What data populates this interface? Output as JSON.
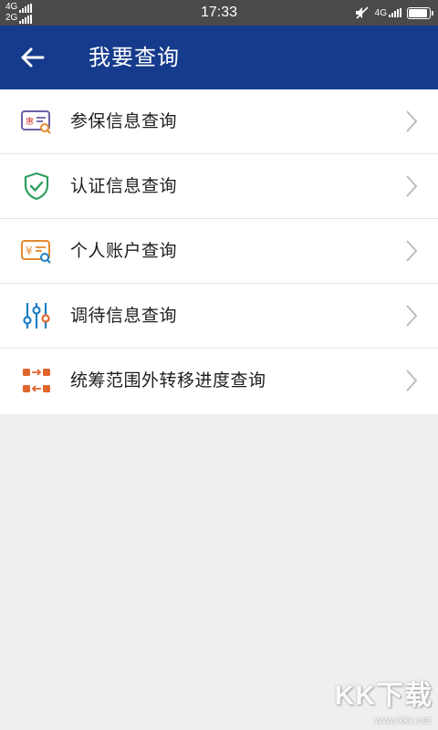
{
  "status_bar": {
    "time": "17:33",
    "sim1_network": "4G",
    "sim2_network": "2G",
    "right_network": "4G",
    "battery_level": 0.95,
    "icons": [
      "signal-bars-icon",
      "mute-icon",
      "battery-icon"
    ]
  },
  "app_bar": {
    "title": "我要查询",
    "back_icon": "arrow-left-icon",
    "background": "#163b8c"
  },
  "menu": {
    "items": [
      {
        "label": "参保信息查询",
        "icon": "insurance-card-search-icon",
        "icon_color": "#6a5fa3"
      },
      {
        "label": "认证信息查询",
        "icon": "shield-check-icon",
        "icon_color": "#2f9e5f"
      },
      {
        "label": "个人账户查询",
        "icon": "yuan-account-search-icon",
        "icon_color": "#e28a2b"
      },
      {
        "label": "调待信息查询",
        "icon": "sliders-icon",
        "icon_color": "#1f7fc4"
      },
      {
        "label": "统筹范围外转移进度查询",
        "icon": "transfer-route-icon",
        "icon_color": "#e0662e"
      }
    ],
    "chevron_icon": "chevron-right-icon"
  },
  "watermark": {
    "logo_text": "KK下载",
    "url": "www.kkx.net"
  }
}
